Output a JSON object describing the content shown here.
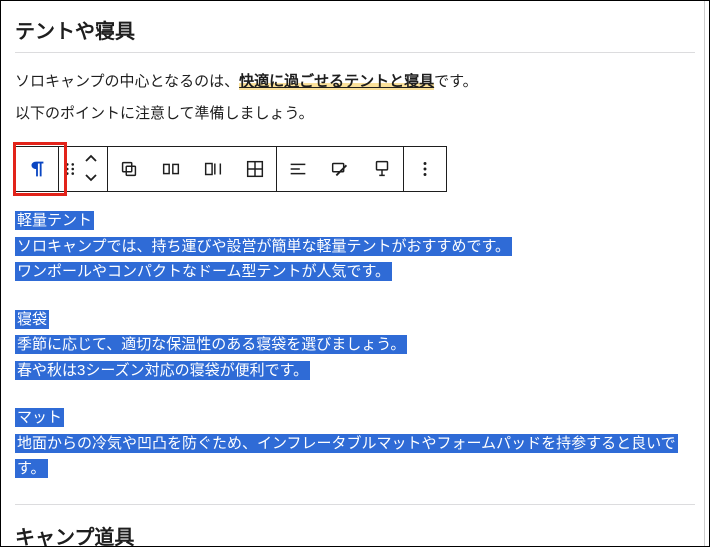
{
  "headings": {
    "tent_sleep": "テントや寝具",
    "camp_tools": "キャンプ道具"
  },
  "intro": {
    "line1_pre": "ソロキャンプの中心となるのは、",
    "line1_highlight": "快適に過ごせるテントと寝具",
    "line1_post": "です。",
    "line2": "以下のポイントに注意して準備しましょう。"
  },
  "toolbar": {
    "block_type": "paragraph",
    "icons": {
      "pilcrow": "paragraph-icon",
      "drag": "drag-handle-icon",
      "up": "move-up-icon",
      "down": "move-down-icon",
      "copy": "copy-icon",
      "duplicate": "duplicate-icon",
      "insert_before": "insert-before-icon",
      "insert_table": "insert-after-icon",
      "align": "align-left-icon",
      "link": "bold-link-icon",
      "caption": "caption-icon",
      "more": "more-options-icon"
    }
  },
  "selected": [
    {
      "title": "軽量テント",
      "lines": [
        "ソロキャンプでは、持ち運びや設営が簡単な軽量テントがおすすめです。",
        "ワンポールやコンパクトなドーム型テントが人気です。"
      ]
    },
    {
      "title": "寝袋",
      "lines": [
        "季節に応じて、適切な保温性のある寝袋を選びましょう。",
        "春や秋は3シーズン対応の寝袋が便利です。"
      ]
    },
    {
      "title": "マット",
      "lines": [
        "地面からの冷気や凹凸を防ぐため、インフレータブルマットやフォームパッドを持参すると良いです。"
      ]
    }
  ]
}
